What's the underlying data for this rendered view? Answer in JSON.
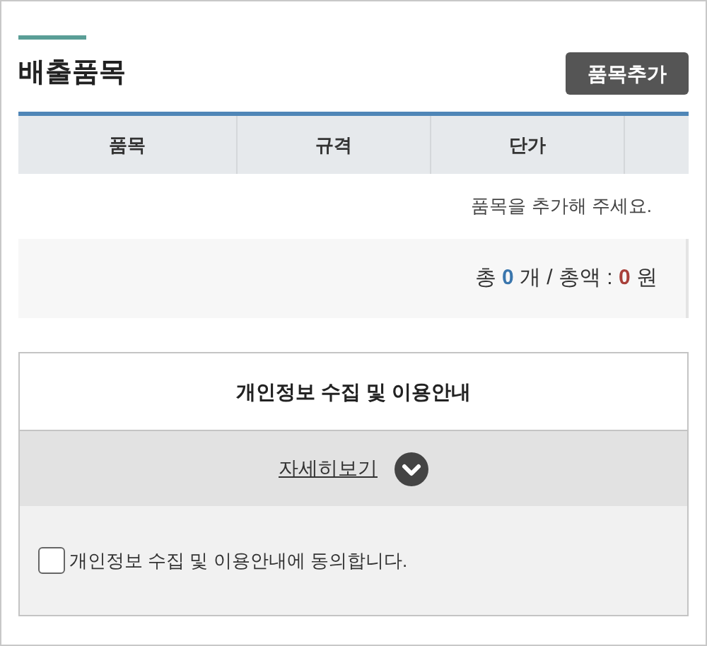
{
  "section": {
    "title": "배출품목",
    "add_button": "품목추가"
  },
  "table": {
    "columns": [
      "품목",
      "규격",
      "단가"
    ],
    "empty_message": "품목을 추가해 주세요."
  },
  "summary": {
    "prefix": "총",
    "count": "0",
    "middle": "개 / 총액 :",
    "amount": "0",
    "suffix": "원"
  },
  "privacy": {
    "title": "개인정보 수집 및 이용안내",
    "details_link": "자세히보기",
    "expanded": false,
    "agree_label": "개인정보 수집 및 이용안내에 동의합니다.",
    "checked": false
  }
}
